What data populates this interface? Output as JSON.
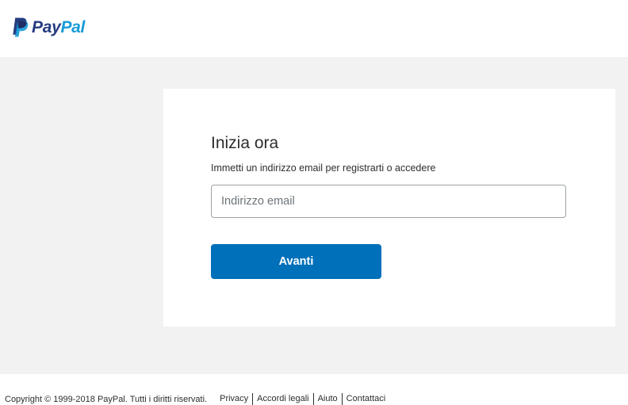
{
  "header": {
    "logo_text_pay": "Pay",
    "logo_text_pal": "Pal",
    "brand_colors": {
      "dark_blue": "#253b80",
      "light_blue": "#179bd7"
    }
  },
  "card": {
    "title": "Inizia ora",
    "subtitle": "Immetti un indirizzo email per registrarti o accedere",
    "email_placeholder": "Indirizzo email",
    "email_value": "",
    "next_button_label": "Avanti"
  },
  "footer": {
    "copyright": "Copyright © 1999-2018 PayPal. Tutti i diritti riservati.",
    "links": [
      "Privacy",
      "Accordi legali",
      "Aiuto",
      "Contattaci"
    ]
  },
  "colors": {
    "accent": "#0070ba",
    "band_background": "#f2f2f2"
  },
  "icons": {
    "logo": "paypal-logo-icon"
  }
}
